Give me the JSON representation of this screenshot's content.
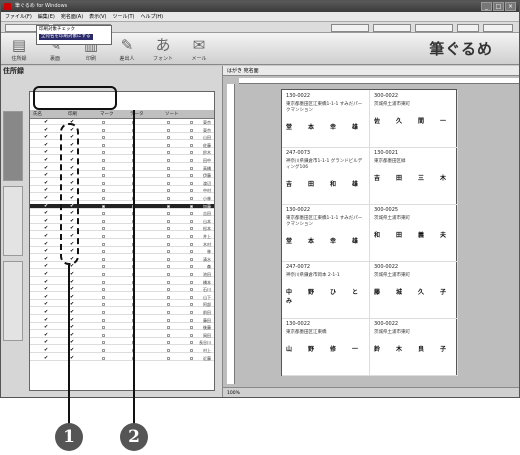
{
  "window": {
    "title": "筆ぐるめ for Windows"
  },
  "menu": [
    "ファイル(F)",
    "編集(E)",
    "宛名面(A)",
    "表示(V)",
    "ツール(T)",
    "ヘルプ(H)"
  ],
  "toolbar": {
    "items": [
      {
        "label": "住所録",
        "icon": "address-book-icon"
      },
      {
        "label": "裏面",
        "icon": "back-side-icon"
      },
      {
        "label": "印刷",
        "icon": "print-icon"
      },
      {
        "label": "差出人",
        "icon": "sender-icon"
      },
      {
        "label": "フォント",
        "icon": "font-icon"
      },
      {
        "label": "メール",
        "icon": "mail-icon"
      }
    ],
    "logo": "筆ぐるめ"
  },
  "left_pane": {
    "title": "住所録",
    "dropdown_options": [
      "印刷対象チェック",
      "全宛名を印刷対象にする"
    ],
    "columns": [
      "氏名",
      "印刷",
      "マーク",
      "データ",
      "ソート"
    ],
    "rows": [
      "東京",
      "東京",
      "山田",
      "佐藤",
      "鈴木",
      "田中",
      "高橋",
      "伊藤",
      "渡辺",
      "中村",
      "小林",
      "加藤",
      "吉田",
      "山本",
      "松本",
      "井上",
      "木村",
      "林",
      "清水",
      "森",
      "池田",
      "橋本",
      "石川",
      "山下",
      "阿部",
      "前田",
      "藤田",
      "後藤",
      "岡田",
      "長谷川",
      "村上",
      "近藤"
    ]
  },
  "right_pane": {
    "header": "はがき  宛名面",
    "labels": [
      {
        "zip": "130-0022",
        "addr": "東京都墨田区江東橋1-1-1  すみだパークマンション",
        "name": "堂　本　幸　雄"
      },
      {
        "zip": "300-0022",
        "addr": "茨城県土浦市東町",
        "name": "佐　久　間　一"
      },
      {
        "zip": "247-0073",
        "addr": "神奈川県鎌倉市1-1-1  グランドビルディング106",
        "name": "吉　田　和　雄"
      },
      {
        "zip": "130-0021",
        "addr": "東京都墨田区緑",
        "name": "吉　田　三　木"
      },
      {
        "zip": "130-0022",
        "addr": "東京都墨田区江東橋1-1-1  すみだパークマンション",
        "name": "堂　本　幸　雄"
      },
      {
        "zip": "300-0025",
        "addr": "茨城県土浦市東町",
        "name": "和　田　義　夫"
      },
      {
        "zip": "247-0072",
        "addr": "神奈川県鎌倉市岡本  2-1-1",
        "name": "中　野　ひ　と　み"
      },
      {
        "zip": "300-0022",
        "addr": "茨城県土浦市東町",
        "name": "藤　城　久　子"
      },
      {
        "zip": "130-0022",
        "addr": "東京都墨田区江東橋",
        "name": "山　野　修　一"
      },
      {
        "zip": "300-0022",
        "addr": "茨城県土浦市東町",
        "name": "鈴　木　良　子"
      }
    ],
    "status": "100%"
  },
  "callouts": [
    "1",
    "2"
  ]
}
